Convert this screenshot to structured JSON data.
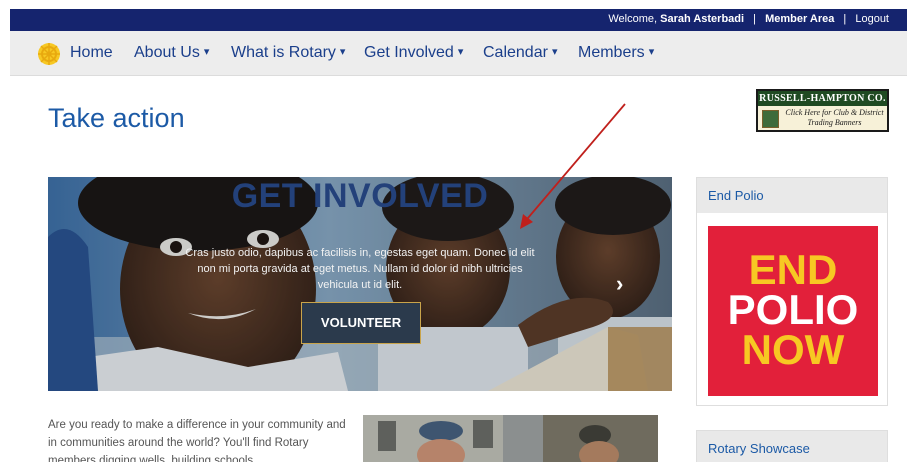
{
  "topbar": {
    "welcome_prefix": "Welcome, ",
    "user_name": "Sarah Asterbadi",
    "member_area": "Member Area",
    "logout": "Logout"
  },
  "nav": {
    "items": [
      {
        "label": "Home",
        "dropdown": false
      },
      {
        "label": "About Us",
        "dropdown": true
      },
      {
        "label": "What is Rotary",
        "dropdown": true
      },
      {
        "label": "Get Involved",
        "dropdown": true
      },
      {
        "label": "Calendar",
        "dropdown": true
      },
      {
        "label": "Members",
        "dropdown": true
      }
    ],
    "caret": "▾"
  },
  "page": {
    "title": "Take action"
  },
  "sponsor": {
    "name": "RUSSELL-HAMPTON CO.",
    "tagline": "Click Here for Club & District Trading Banners"
  },
  "hero": {
    "title": "GET INVOLVED",
    "text": "Cras justo odio, dapibus ac facilisis in, egestas eget quam. Donec id elit non mi porta gravida at eget metus. Nullam id dolor id nibh ultricies vehicula ut id elit.",
    "button": "VOLUNTEER",
    "next_arrow": "›"
  },
  "intro": {
    "text": "Are you ready to make a difference in your community and in communities around the world? You'll find Rotary members digging wells, building schools,"
  },
  "sidebar": {
    "end_polio": {
      "heading": "End Polio",
      "logo_lines": [
        "END",
        "POLIO",
        "NOW"
      ]
    },
    "showcase": {
      "heading": "Rotary Showcase"
    }
  },
  "colors": {
    "topbar": "#15246e",
    "nav_text": "#1b3f8b",
    "heading": "#1c5aa6",
    "polio_red": "#e2203a",
    "polio_yellow": "#f7c823"
  }
}
